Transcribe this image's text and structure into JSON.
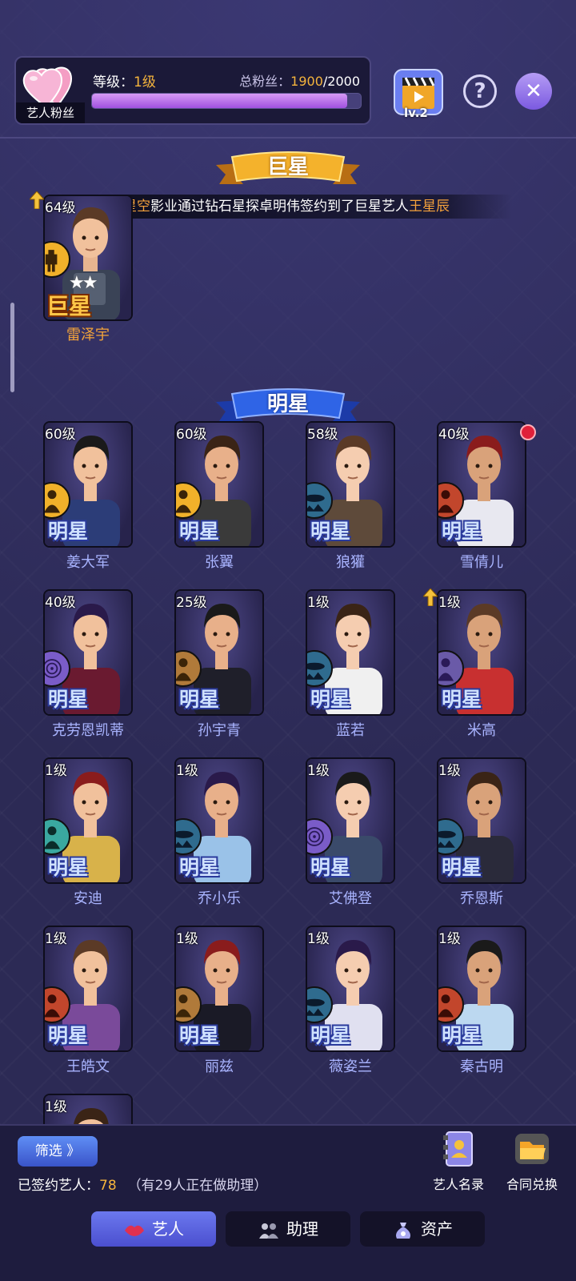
{
  "header": {
    "fan_tag": "艺人粉丝",
    "level_label": "等级：",
    "level_value": "1级",
    "fans_label": "总粉丝：",
    "fans_current": "1900",
    "fans_sep": "/",
    "fans_total": "2000",
    "fans_progress": 0.95,
    "studio_level": "lv.2",
    "help_symbol": "?",
    "close_symbol": "✕"
  },
  "superstar": {
    "banner": "巨星",
    "notice": {
      "p1": "坠落星空",
      "p2": "影业通过钻石星探卓明伟签约到了巨星艺人",
      "p3": "王星辰"
    },
    "card": {
      "level": "64级",
      "tier": "巨星",
      "stars": "★★",
      "name": "雷泽宇",
      "badge": "soldier-badge-icon"
    }
  },
  "stars": {
    "banner": "明星",
    "tier_label": "明星",
    "cards": [
      {
        "level": "60级",
        "name": "姜大军",
        "badge": "soldier"
      },
      {
        "level": "60级",
        "name": "张翼",
        "badge": "soldier"
      },
      {
        "level": "58级",
        "name": "狼獾",
        "badge": "ufo"
      },
      {
        "level": "40级",
        "name": "雪倩儿",
        "badge": "silhouette"
      },
      {
        "level": "40级",
        "name": "克劳恩凯蒂",
        "badge": "fingerprint"
      },
      {
        "level": "25级",
        "name": "孙宇青",
        "badge": "warrior"
      },
      {
        "level": "1级",
        "name": "蓝若",
        "badge": "ufo"
      },
      {
        "level": "1级",
        "name": "米高",
        "badge": "heart"
      },
      {
        "level": "1级",
        "name": "安迪",
        "badge": "runner"
      },
      {
        "level": "1级",
        "name": "乔小乐",
        "badge": "ufo"
      },
      {
        "level": "1级",
        "name": "艾佛登",
        "badge": "fingerprint"
      },
      {
        "level": "1级",
        "name": "乔恩斯",
        "badge": "ufo"
      },
      {
        "level": "1级",
        "name": "王皓文",
        "badge": "silhouette"
      },
      {
        "level": "1级",
        "name": "丽兹",
        "badge": "warrior"
      },
      {
        "level": "1级",
        "name": "薇姿兰",
        "badge": "ufo"
      },
      {
        "level": "1级",
        "name": "秦古明",
        "badge": "silhouette"
      },
      {
        "level": "1级",
        "name": "",
        "badge": ""
      }
    ]
  },
  "footer": {
    "filter_button": "筛选 》",
    "signed_label": "已签约艺人：",
    "signed_count": "78",
    "assistant_note": "（有29人正在做助理）",
    "roster_label": "艺人名录",
    "contract_label": "合同兑换"
  },
  "tabs": [
    {
      "label": "艺人",
      "active": true
    },
    {
      "label": "助理",
      "active": false
    },
    {
      "label": "资产",
      "active": false
    }
  ],
  "colors": {
    "accent_gold": "#f5b43c",
    "star_blue": "#a9b4ff",
    "bg": "#2c2a55",
    "active_tab": "#5a62dc"
  }
}
